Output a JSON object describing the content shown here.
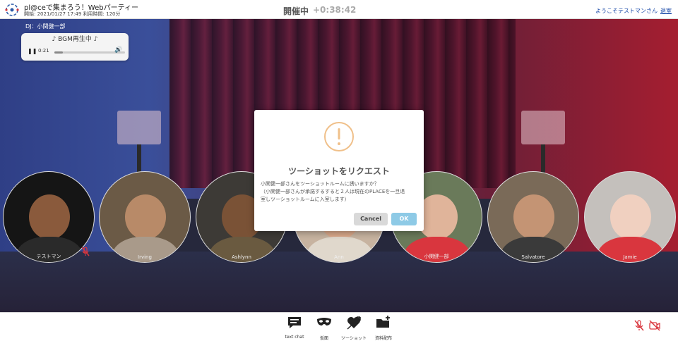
{
  "header": {
    "app_name": "pl@ceで集まろう！Webパーティー",
    "meta": "開始: 2021/01/27 17:49  利用時間: 120分",
    "status": "開催中",
    "timer": "+0:38:42",
    "welcome": "ようこそテストマンさん",
    "leave": "退室"
  },
  "dj": {
    "label": "DJ：小関健一部",
    "bgm_title": "♪  BGM再生中  ♪",
    "time": "0:21",
    "progress": 0.12
  },
  "participants": [
    {
      "name": "テストマン"
    },
    {
      "name": "Irving"
    },
    {
      "name": "Ashlynn"
    },
    {
      "name": "Ann"
    },
    {
      "name": "小関健一部"
    },
    {
      "name": "Salvatore"
    },
    {
      "name": "Jamie"
    }
  ],
  "modal": {
    "title": "ツーショットをリクエスト",
    "line1": "小関健一部さんをツーショットルームに誘いますか？",
    "line2": "（小関健一部さんが承諾するすると２人は現在のPLACEを一旦退",
    "line3": "室しツーショットルームに入室します）",
    "cancel": "Cancel",
    "ok": "OK"
  },
  "toolbar": {
    "items": [
      {
        "label": "text chat",
        "icon": "chat-icon"
      },
      {
        "label": "仮面",
        "icon": "mask-icon"
      },
      {
        "label": "ツーショット",
        "icon": "two-shot-icon"
      },
      {
        "label": "資料配布",
        "icon": "folder-plus-icon"
      }
    ]
  },
  "colors": {
    "accent_red": "#d9363e",
    "ok_button": "#8ecae6",
    "warning": "#f0c08a",
    "link": "#1a4aa8"
  }
}
